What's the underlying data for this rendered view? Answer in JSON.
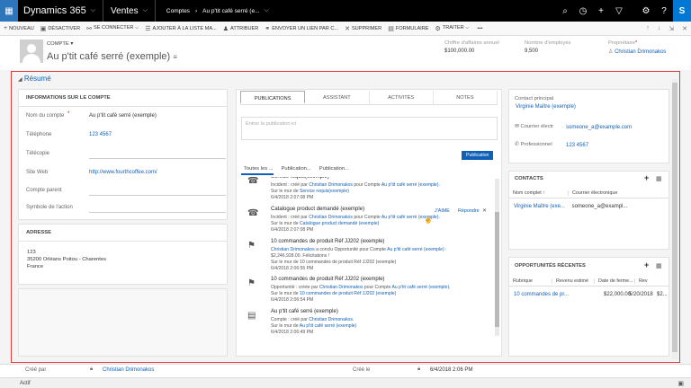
{
  "nav": {
    "app_name": "Dynamics 365",
    "area": "Ventes",
    "breadcrumb_entity": "Comptes",
    "breadcrumb_record": "Au p'tit café serré (e...",
    "chevron": "⌵",
    "arrow": "›"
  },
  "commands": [
    {
      "icon": "+",
      "label": "NOUVEAU"
    },
    {
      "icon": "▣",
      "label": "DÉSACTIVER"
    },
    {
      "icon": "⚯",
      "label": "SE CONNECTER ⌵"
    },
    {
      "icon": "☰",
      "label": "AJOUTER À LA LISTE MA..."
    },
    {
      "icon": "♟",
      "label": "ATTRIBUER"
    },
    {
      "icon": "⚭",
      "label": "ENVOYER UN LIEN PAR C..."
    },
    {
      "icon": "✕",
      "label": "SUPPRIMER"
    },
    {
      "icon": "▤",
      "label": "FORMULAIRE"
    },
    {
      "icon": "⚙",
      "label": "TRAITER ⌵"
    },
    {
      "icon": "",
      "label": "•••"
    }
  ],
  "header": {
    "entity_label": "COMPTE ▾",
    "record_name": "Au p'tit café serré (exemple)",
    "revenue_label": "Chiffre d'affaires annuel",
    "revenue_value": "$100,000.00",
    "employees_label": "Nombre d'employés",
    "employees_value": "9,500",
    "owner_label": "Propriétaire",
    "owner_value": "Christian Drimonakos"
  },
  "resume_label": "Résumé",
  "account_info": {
    "title": "INFORMATIONS SUR LE COMPTE",
    "fields": [
      {
        "label": "Nom du compte",
        "value": "Au p'tit café serré (exemple)"
      },
      {
        "label": "Téléphone",
        "value": "123 4567"
      },
      {
        "label": "Télécopie",
        "value": ""
      },
      {
        "label": "Site Web",
        "value": "http://www.fourthcoffee.com/"
      },
      {
        "label": "Compte parent",
        "value": ""
      },
      {
        "label": "Symbole de l'action",
        "value": ""
      }
    ]
  },
  "address": {
    "title": "ADRESSE",
    "line1": "123",
    "line2": "35200 Orléans Poitou - Charentes",
    "line3": "France"
  },
  "timeline": {
    "tabs": [
      "PUBLICATIONS",
      "ASSISTANT",
      "ACTIVITÉS",
      "NOTES"
    ],
    "post_placeholder": "Entrer la publication ici",
    "publish_button": "Publication",
    "subtabs": [
      "Toutes les ...",
      "Publication...",
      "Publication..."
    ],
    "activities": [
      {
        "title": "Service requis(exemple)",
        "line1_pre": "Incident : créé par ",
        "line1_user": "Christian Drimonakos",
        "line1_mid": " pour Compte ",
        "line1_link": "Au p'tit café serré (exemple).",
        "line2_pre": "Sur le mur de ",
        "line2_link": "Service requis(exemple)",
        "date": "6/4/2018 2:07:08 PM"
      },
      {
        "title": "Catalogue product demandé (exemple)",
        "line1_pre": "Incident : créé par ",
        "line1_user": "Christian Drimonakos",
        "line1_mid": " pour Compte ",
        "line1_link": "Au p'tit café serré (exemple).",
        "line2_pre": "Sur le mur de ",
        "line2_link": "Catalogue product demandé (exemple)",
        "date": "6/4/2018 2:07:08 PM"
      },
      {
        "title": "10 commandes de produit Réf JJ202 (exemple)",
        "line1_pre": "",
        "line1_user": "Christian Drimonakos",
        "line1_mid": " a conclu Opportunité pour Compte ",
        "line1_link": "Au p'tit café serré (exemple) :",
        "line2_pre": "$2,246,928.00. Félicitations !",
        "line2_link": "",
        "line3": "Sur le mur de 10 commandes de produit Réf JJ202 (exemple)",
        "date": "6/4/2018 2:06:55 PM"
      },
      {
        "title": "10 commandes de produit Réf JJ202 (exemple)",
        "line1_pre": "Opportunité : créée par ",
        "line1_user": "Christian Drimonakos",
        "line1_mid": " pour Compte ",
        "line1_link": "Au p'tit café serré (exemple).",
        "line2_pre": "Sur le mur de ",
        "line2_link": "10 commandes de produit Réf JJ202 (exemple)",
        "date": "6/4/2018 2:06:54 PM"
      },
      {
        "title": "Au p'tit café serré (exemple)",
        "line1_pre": "Compte : créé par ",
        "line1_user": "Christian Drimonakos.",
        "line1_mid": "",
        "line1_link": "",
        "line2_pre": "Sur le mur de ",
        "line2_link": "Au p'tit café serré (exemple)",
        "date": "6/4/2018 2:06:49 PM"
      }
    ],
    "like_label": "J'AIME",
    "reply_label": "Répondre",
    "close_label": "✕"
  },
  "contact": {
    "primary_label": "Contact principal",
    "primary_value": "Virginie Maître (exemple)",
    "email_label": "Courrier électr",
    "email_value": "someone_a@example.com",
    "phone_label": "Professionnel",
    "phone_value": "123 4567"
  },
  "contacts_grid": {
    "title": "CONTACTS",
    "col1": "Nom complet ↑",
    "col2": "Courrier électronique",
    "row_name": "Virginie Maître (exe...",
    "row_email": "someone_a@exampl..."
  },
  "opps_grid": {
    "title": "OPPORTUNITÉS RÉCENTES",
    "col1": "Rubrique",
    "col2": "Revenu estimé",
    "col3": "Date de ferme...",
    "col4": "Rev",
    "row_topic": "10 commandes de pr...",
    "row_revenue": "$22,000.00",
    "row_date": "5/20/2018",
    "row_rev": "$2..."
  },
  "footer": {
    "created_by_label": "Créé par",
    "created_by_value": "Christian Drimonakos",
    "created_on_label": "Créé le",
    "created_on_value": "6/4/2018  2:06 PM",
    "status": "Actif"
  }
}
